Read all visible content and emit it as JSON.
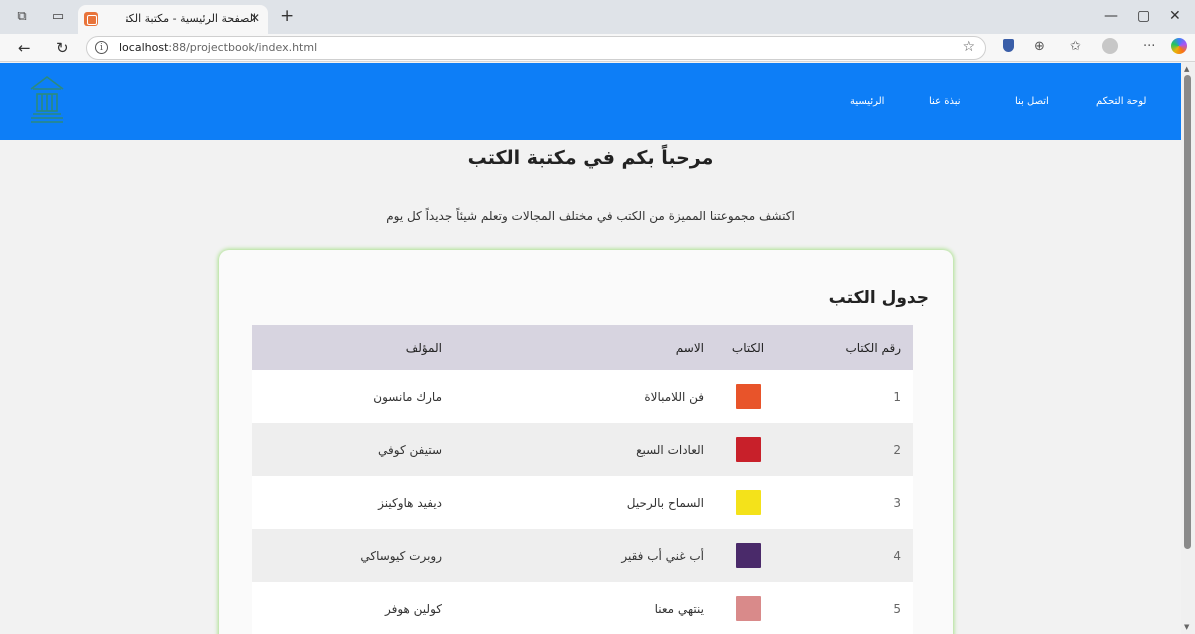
{
  "browser": {
    "tab_title": "الصفحة الرئيسية - مكتبة الكتب",
    "url_host": "localhost",
    "url_rest": ":88/projectbook/index.html"
  },
  "navbar": {
    "links": [
      "لوحة التحكم",
      "اتصل بنا",
      "نبذة عنا",
      "الرئيسية"
    ]
  },
  "hero": {
    "title": "مرحباً بكم في مكتبة الكتب",
    "subtitle": "اكتشف مجموعتنا المميزة من الكتب في مختلف المجالات وتعلم شيئاً جديداً كل يوم"
  },
  "table": {
    "title": "جدول الكتب",
    "headers": {
      "num": "رقم الكتاب",
      "book": "الكتاب",
      "name": "الاسم",
      "author": "المؤلف"
    },
    "rows": [
      {
        "num": "1",
        "name": "فن اللامبالاة",
        "author": "مارك مانسون",
        "cover_color": "#e8542a"
      },
      {
        "num": "2",
        "name": "العادات السبع",
        "author": "ستيفن كوفي",
        "cover_color": "#c8202a"
      },
      {
        "num": "3",
        "name": "السماح بالرحيل",
        "author": "ديفيد هاوكينز",
        "cover_color": "#f4e21a"
      },
      {
        "num": "4",
        "name": "أب غني أب فقير",
        "author": "روبرت كيوساكي",
        "cover_color": "#4a2a6a"
      },
      {
        "num": "5",
        "name": "ينتهي معنا",
        "author": "كولين هوفر",
        "cover_color": "#d98a8a"
      }
    ]
  },
  "colors": {
    "navbar": "#0d7ef7",
    "table_header": "#d7d4e0",
    "card_glow": "#a8e08a"
  }
}
